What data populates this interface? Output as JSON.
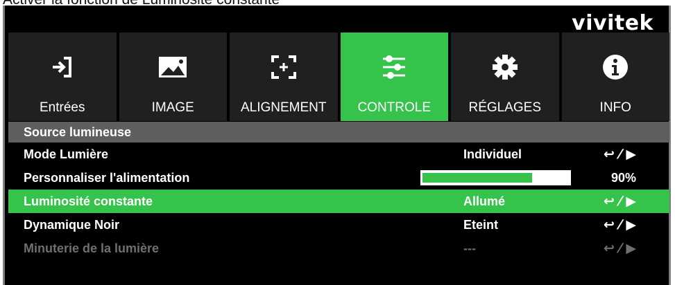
{
  "caption": "Activer la fonction de Luminosité constante",
  "brand": "vivitek",
  "tabs": [
    {
      "label": "Entrées",
      "icon": "input-icon",
      "active": false
    },
    {
      "label": "IMAGE",
      "icon": "image-icon",
      "active": false
    },
    {
      "label": "ALIGNEMENT",
      "icon": "alignment-icon",
      "active": false
    },
    {
      "label": "CONTROLE",
      "icon": "sliders-icon",
      "active": true
    },
    {
      "label": "RÉGLAGES",
      "icon": "gear-icon",
      "active": false
    },
    {
      "label": "INFO",
      "icon": "info-icon",
      "active": false
    }
  ],
  "section": "Source lumineuse",
  "rows": [
    {
      "label": "Mode Lumière",
      "value": "Individuel",
      "action": "↩ ⁄ ▶"
    },
    {
      "label": "Personnaliser l'alimentation",
      "percent": "90%",
      "level": 0.75
    },
    {
      "label": "Luminosité constante",
      "value": "Allumé",
      "action": "↩ ⁄ ▶"
    },
    {
      "label": "Dynamique Noir",
      "value": "Eteint",
      "action": "↩ ⁄ ▶"
    },
    {
      "label": "Minuterie de la lumière",
      "value": "---",
      "action": "↩ ⁄ ▶"
    }
  ],
  "colors": {
    "accent": "#35c34b",
    "tab_bg": "#202020",
    "header_bg": "#5f5f5f",
    "disabled_text": "#6f6f6f"
  }
}
